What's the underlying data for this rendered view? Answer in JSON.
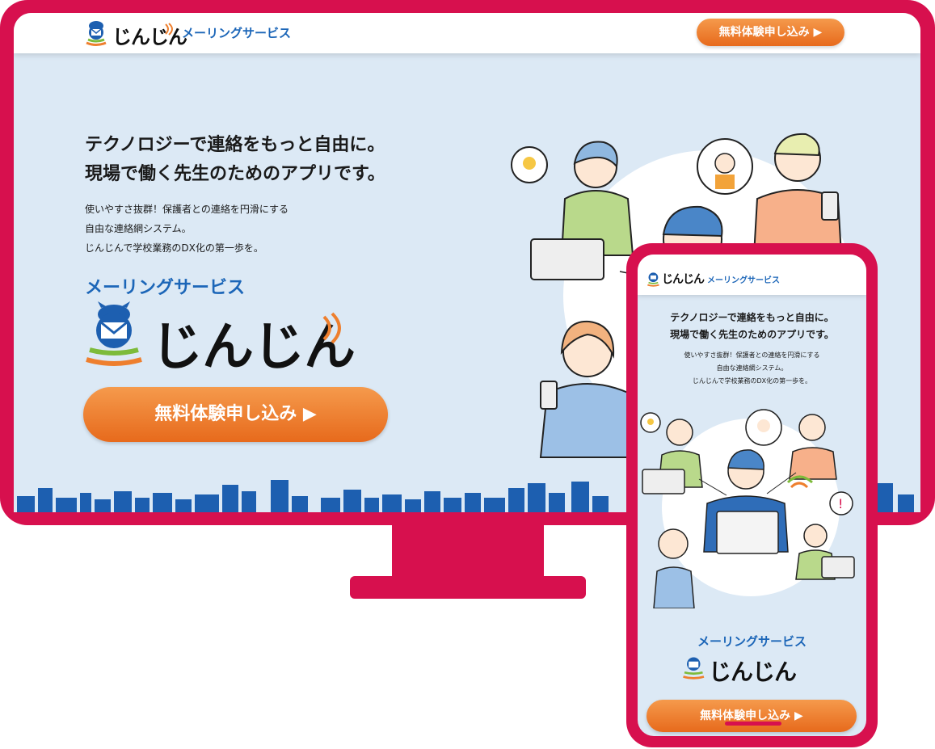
{
  "brand": {
    "logo_text": "じんじん",
    "service_name": "メーリングサービス"
  },
  "header": {
    "cta_label": "無料体験申し込み ▶"
  },
  "hero": {
    "headline_line1": "テクノロジーで連絡をもっと自由に。",
    "headline_line2": "現場で働く先生のためのアプリです。",
    "body_line1": "使いやすさ抜群！保護者との連絡を円滑にする",
    "body_line2": "自由な連絡網システム。",
    "body_line3": "じんじんで学校業務のDX化の第一歩を。",
    "service_name": "メーリングサービス",
    "logo_text": "じんじん",
    "cta_label": "無料体験申し込み ▶"
  },
  "mobile": {
    "logo_text": "じんじん",
    "service_name": "メーリングサービス",
    "headline_line1": "テクノロジーで連絡をもっと自由に。",
    "headline_line2": "現場で働く先生のためのアプリです。",
    "body_line1": "使いやすさ抜群！保護者との連絡を円滑にする",
    "body_line2": "自由な連絡網システム。",
    "body_line3": "じんじんで学校業務のDX化の第一歩を。",
    "bottom_service_name": "メーリングサービス",
    "bottom_logo_text": "じんじん",
    "cta_label": "無料体験申し込み ▶"
  },
  "colors": {
    "device_frame": "#d7104e",
    "screen_bg": "#dce9f5",
    "brand_blue": "#1c66b8",
    "cta_orange": "#ee7f2e",
    "city_blue": "#1d5fb0"
  },
  "icons": {
    "mascot": "mail-bird-mascot-icon",
    "cta_arrow": "play-triangle-icon"
  }
}
